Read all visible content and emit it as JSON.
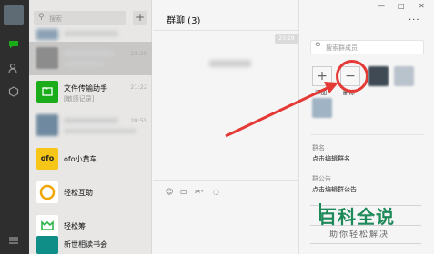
{
  "sidebar": {
    "icons": [
      "avatar",
      "chat-icon",
      "contacts-icon",
      "favorites-icon",
      "menu-icon"
    ]
  },
  "conversation_list": {
    "search_placeholder": "搜索",
    "add_button": "+",
    "items": [
      {
        "name": "",
        "time": "",
        "sub": ""
      },
      {
        "name": "",
        "time": "23:29",
        "sub": ""
      },
      {
        "name": "文件传输助手",
        "time": "21:22",
        "sub": "[敏感记录]"
      },
      {
        "name": "",
        "time": "20:55",
        "sub": ""
      },
      {
        "name": "ofo小黄车",
        "time": "",
        "sub": ""
      },
      {
        "name": "轻松互助",
        "time": "",
        "sub": ""
      },
      {
        "name": "轻松筹",
        "time": "",
        "sub": ""
      },
      {
        "name": "新世相读书会",
        "time": "",
        "sub": ""
      }
    ]
  },
  "chat": {
    "title": "群聊 (3)",
    "time_label": "23:29",
    "toolbar_icons": [
      "emoji-icon",
      "folder-icon",
      "scissors-icon",
      "chat-bubble-icon"
    ]
  },
  "group_info": {
    "window_controls": [
      "—",
      "□",
      "✕"
    ],
    "more": "...",
    "member_search_placeholder": "搜索群成员",
    "add_label": "添加",
    "remove_label": "删除",
    "group_name_label": "群名",
    "group_name_value": "点击编辑群名",
    "notice_label": "群公告",
    "notice_value": "点击编辑群公告"
  },
  "watermark": {
    "title": "百科全说",
    "subtitle": "助你轻松解决"
  },
  "colors": {
    "annotation": "#e53935",
    "sidebar": "#2e2e2e",
    "wechat_green": "#1aad19",
    "watermark_green": "#1e8a5a"
  }
}
